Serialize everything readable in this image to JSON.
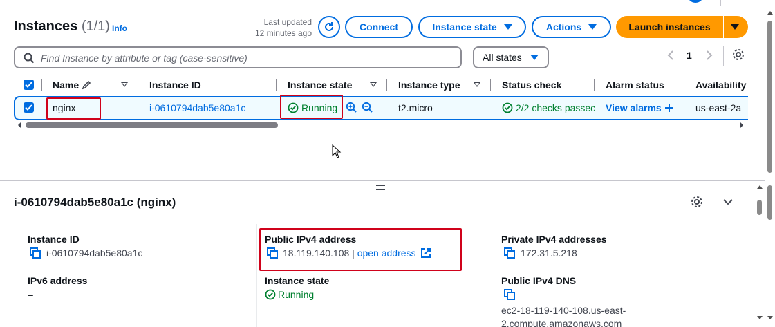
{
  "header": {
    "title": "Instances",
    "count": "(1/1)",
    "info": "Info",
    "last_updated_line1": "Last updated",
    "last_updated_line2": "12 minutes ago",
    "connect": "Connect",
    "instance_state": "Instance state",
    "actions": "Actions",
    "launch": "Launch instances"
  },
  "search": {
    "placeholder": "Find Instance by attribute or tag (case-sensitive)",
    "filter": "All states",
    "page": "1"
  },
  "table": {
    "columns": [
      "Name",
      "Instance ID",
      "Instance state",
      "Instance type",
      "Status check",
      "Alarm status",
      "Availability"
    ],
    "row": {
      "name": "nginx",
      "instance_id": "i-0610794dab5e80a1c",
      "state": "Running",
      "type": "t2.micro",
      "status_check": "2/2 checks passec",
      "alarm": "View alarms",
      "availability": "us-east-2a"
    }
  },
  "details": {
    "title": "i-0610794dab5e80a1c (nginx)",
    "instance_id_label": "Instance ID",
    "instance_id_value": "i-0610794dab5e80a1c",
    "ipv6_label": "IPv6 address",
    "ipv6_value": "–",
    "public_ipv4_label": "Public IPv4 address",
    "public_ipv4_value": "18.119.140.108",
    "public_ipv4_sep": "|",
    "open_address": "open address",
    "state_label": "Instance state",
    "state_value": "Running",
    "private_ipv4_label": "Private IPv4 addresses",
    "private_ipv4_value": "172.31.5.218",
    "public_dns_label": "Public IPv4 DNS",
    "public_dns_line1": "ec2-18-119-140-108.us-east-",
    "public_dns_line2": "2.compute.amazonaws.com"
  },
  "colors": {
    "accent": "#006ce0",
    "launch": "#ff9900",
    "running": "#00802f",
    "highlight": "#d0021b"
  }
}
